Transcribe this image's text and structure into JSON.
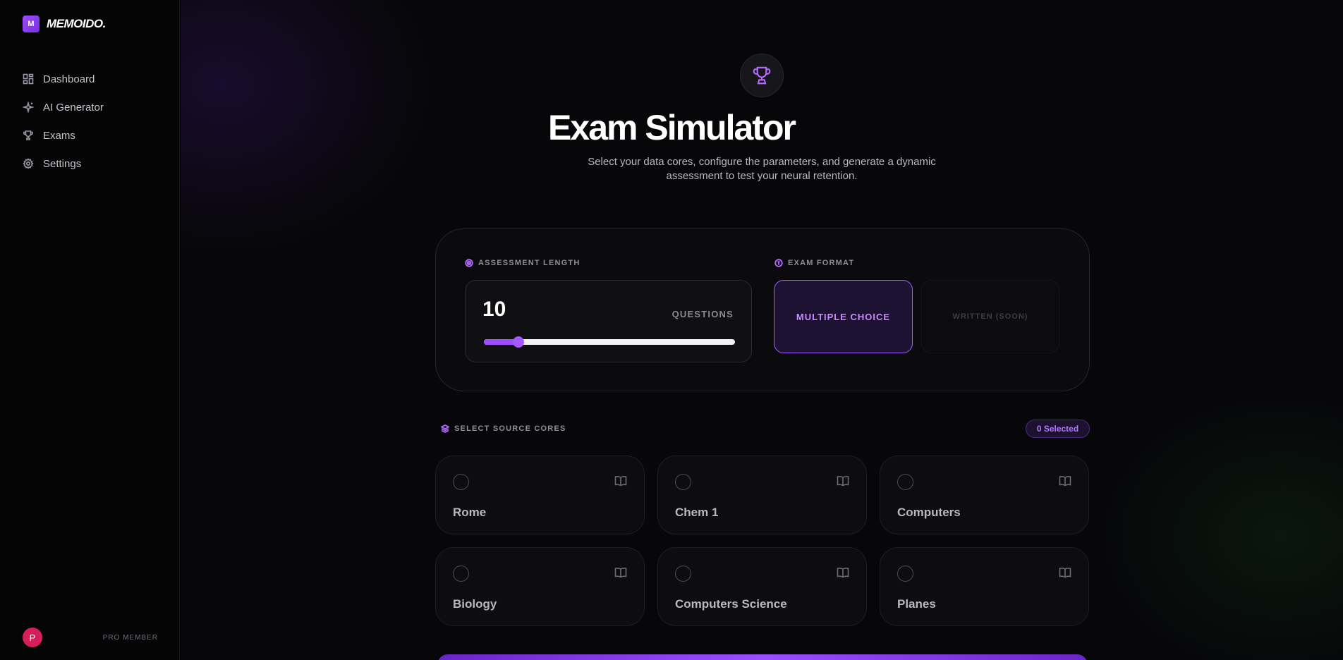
{
  "brand": {
    "badge": "M",
    "name": "MEMOIDO."
  },
  "nav": [
    {
      "label": "Dashboard",
      "icon": "dashboard-icon"
    },
    {
      "label": "AI Generator",
      "icon": "sparkles-icon"
    },
    {
      "label": "Exams",
      "icon": "trophy-icon"
    },
    {
      "label": "Settings",
      "icon": "gear-icon"
    }
  ],
  "user": {
    "initial": "P",
    "tier": "PRO MEMBER"
  },
  "header": {
    "title": "Exam Simulator",
    "subtitle": "Select your data cores, configure the parameters, and generate a dynamic assessment to test your neural retention."
  },
  "config": {
    "length_label": "ASSESSMENT LENGTH",
    "count": "10",
    "count_unit": "QUESTIONS",
    "slider": {
      "value": 10,
      "min": 5,
      "max": 50
    },
    "format_label": "EXAM FORMAT",
    "formats": [
      {
        "label": "MULTIPLE CHOICE",
        "active": true
      },
      {
        "label": "WRITTEN (SOON)",
        "active": false
      }
    ]
  },
  "sources": {
    "label": "SELECT SOURCE CORES",
    "selected_badge": "0 Selected",
    "cores": [
      "Rome",
      "Chem 1",
      "Computers",
      "Biology",
      "Computers Science",
      "Planes"
    ]
  },
  "colors": {
    "accent": "#9b4dff",
    "background": "#070709",
    "avatar": "#d61f5a"
  }
}
